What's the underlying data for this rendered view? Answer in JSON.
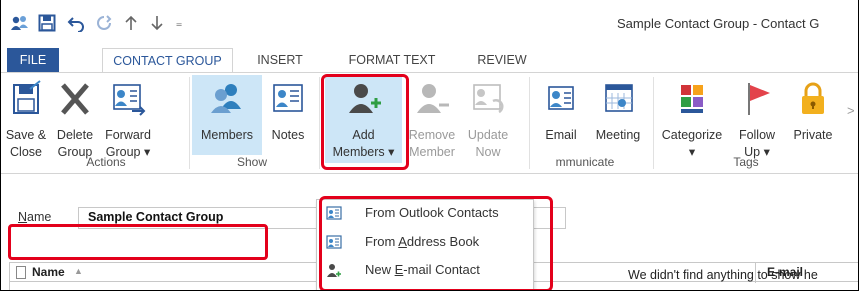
{
  "window": {
    "title": "Sample Contact Group - Contact G"
  },
  "tabs": [
    {
      "label": "FILE"
    },
    {
      "label": "CONTACT GROUP"
    },
    {
      "label": "INSERT"
    },
    {
      "label": "FORMAT TEXT"
    },
    {
      "label": "REVIEW"
    }
  ],
  "ribbon": {
    "save_close": {
      "line1": "Save &",
      "line2": "Close"
    },
    "delete_group": {
      "line1": "Delete",
      "line2": "Group"
    },
    "forward_group": {
      "line1": "Forward",
      "line2": "Group ▾"
    },
    "members": {
      "label": "Members"
    },
    "notes": {
      "label": "Notes"
    },
    "add_members": {
      "line1": "Add",
      "line2": "Members ▾"
    },
    "remove_member": {
      "line1": "Remove",
      "line2": "Member"
    },
    "update_now": {
      "line1": "Update",
      "line2": "Now"
    },
    "email": {
      "label": "Email"
    },
    "meeting": {
      "label": "Meeting"
    },
    "categorize": {
      "line1": "Categorize",
      "line2": "▾"
    },
    "follow_up": {
      "line1": "Follow",
      "line2": "Up ▾"
    },
    "private": {
      "label": "Private"
    },
    "groups": {
      "actions": "Actions",
      "show": "Show",
      "communicate": "mmunicate",
      "tags": "Tags"
    }
  },
  "name_field": {
    "label_first": "N",
    "label_rest": "ame",
    "value": "Sample Contact Group"
  },
  "table": {
    "col_name": "Name",
    "col_email": "E-mail",
    "empty_message": "We didn't find anything to show he"
  },
  "add_members_menu": {
    "items": [
      {
        "label": "From Outlook Contacts",
        "icon": "address-book-icon"
      },
      {
        "label_pre": "From ",
        "label_u": "A",
        "label_post": "ddress Book",
        "icon": "address-book-icon"
      },
      {
        "label_pre": "New ",
        "label_u": "E",
        "label_post": "-mail Contact",
        "icon": "new-contact-icon"
      }
    ]
  },
  "colors": {
    "accent": "#2b579a",
    "highlight": "#e3001b",
    "selected_bg": "#cde6f7"
  }
}
